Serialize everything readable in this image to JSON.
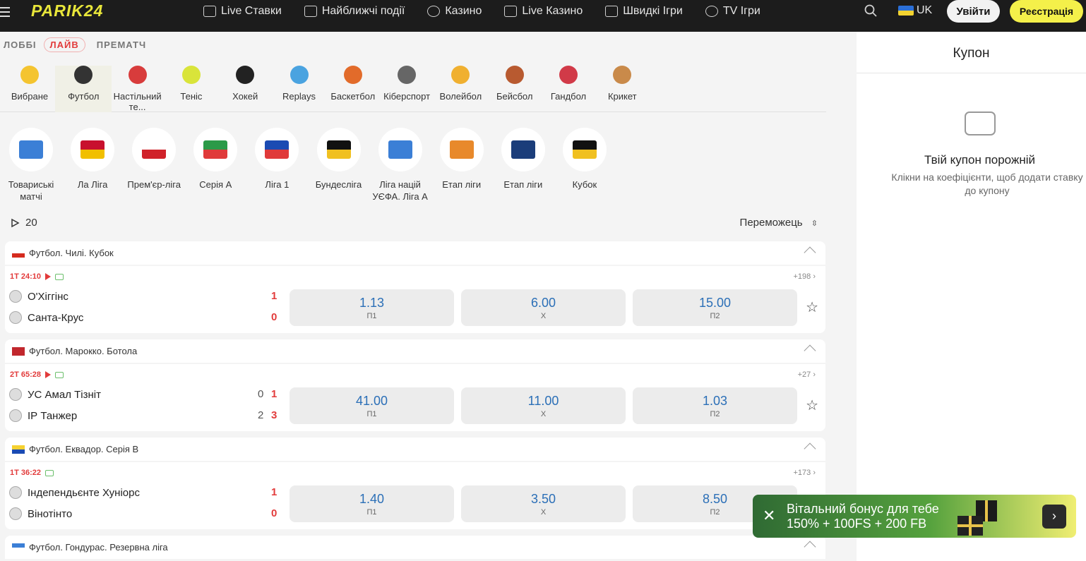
{
  "header": {
    "logo": "PARIK24",
    "nav": [
      {
        "label": "Live Ставки",
        "icon": "live-bets-icon"
      },
      {
        "label": "Найближчі події",
        "icon": "calendar-icon"
      },
      {
        "label": "Казино",
        "icon": "casino-chip-icon"
      },
      {
        "label": "Live Казино",
        "icon": "live-casino-icon"
      },
      {
        "label": "Швидкі Ігри",
        "icon": "rocket-icon"
      },
      {
        "label": "TV Ігри",
        "icon": "tv-games-icon"
      }
    ],
    "language": "UK",
    "login": "Увійти",
    "register": "Реєстрація"
  },
  "tabs": [
    "ЛОББІ",
    "ЛАЙВ",
    "ПРЕМАТЧ"
  ],
  "active_tab": "ЛАЙВ",
  "sports": [
    {
      "label": "Вибране",
      "color": "#f4c430"
    },
    {
      "label": "Футбол",
      "color": "#333333"
    },
    {
      "label": "Настільний те...",
      "color": "#d83c3c"
    },
    {
      "label": "Теніс",
      "color": "#d9e43a"
    },
    {
      "label": "Хокей",
      "color": "#222222"
    },
    {
      "label": "Replays",
      "color": "#4aa3e0"
    },
    {
      "label": "Баскетбол",
      "color": "#e26b2a"
    },
    {
      "label": "Кіберспорт",
      "color": "#666666"
    },
    {
      "label": "Волейбол",
      "color": "#f0b030"
    },
    {
      "label": "Бейсбол",
      "color": "#b85a30"
    },
    {
      "label": "Гандбол",
      "color": "#d13a48"
    },
    {
      "label": "Крикет",
      "color": "#c98a4a"
    }
  ],
  "leagues": [
    {
      "label": "Товариські матчі",
      "colors": [
        "#3b7fd6",
        "#3b7fd6"
      ]
    },
    {
      "label": "Ла Ліга",
      "colors": [
        "#c8102e",
        "#f1bf00"
      ]
    },
    {
      "label": "Прем'єр-ліга",
      "colors": [
        "#ffffff",
        "#d0222a"
      ]
    },
    {
      "label": "Серія А",
      "colors": [
        "#2b9a48",
        "#e03a3a"
      ]
    },
    {
      "label": "Ліга 1",
      "colors": [
        "#1b4bb3",
        "#e03a3a"
      ]
    },
    {
      "label": "Бундесліга",
      "colors": [
        "#111111",
        "#f0c020"
      ]
    },
    {
      "label": "Ліга націй УЄФА. Ліга А",
      "colors": [
        "#3b7fd6",
        "#3b7fd6"
      ]
    },
    {
      "label": "Етап ліги",
      "colors": [
        "#e8892b",
        "#e8892b"
      ]
    },
    {
      "label": "Етап ліги",
      "colors": [
        "#1b3d7a",
        "#1b3d7a"
      ]
    },
    {
      "label": "Кубок",
      "colors": [
        "#111111",
        "#f0c020"
      ]
    }
  ],
  "live_count": "20",
  "market_selector": "Переможець",
  "groups": [
    {
      "title": "Футбол. Чилі. Кубок",
      "flag": [
        "#ffffff",
        "#d52b1e"
      ],
      "time": "1Т 24:10",
      "more": "+198",
      "teams": [
        {
          "name": "О'Хіггінс",
          "score": "1",
          "period": ""
        },
        {
          "name": "Санта-Крус",
          "score": "0",
          "period": ""
        }
      ],
      "odds": [
        {
          "v": "1.13",
          "l": "П1"
        },
        {
          "v": "6.00",
          "l": "Х"
        },
        {
          "v": "15.00",
          "l": "П2"
        }
      ]
    },
    {
      "title": "Футбол. Марокко. Ботола",
      "flag": [
        "#c1272d",
        "#c1272d"
      ],
      "time": "2Т 65:28",
      "more": "+27",
      "teams": [
        {
          "name": "УС Амал Тізніт",
          "score": "1",
          "period": "0"
        },
        {
          "name": "ІР Танжер",
          "score": "3",
          "period": "2"
        }
      ],
      "odds": [
        {
          "v": "41.00",
          "l": "П1"
        },
        {
          "v": "11.00",
          "l": "Х"
        },
        {
          "v": "1.03",
          "l": "П2"
        }
      ]
    },
    {
      "title": "Футбол. Еквадор. Серія B",
      "flag": [
        "#f5d130",
        "#1b4bb3"
      ],
      "time": "1Т 36:22",
      "more": "+173",
      "teams": [
        {
          "name": "Індепендьєнте Хуніорс",
          "score": "1",
          "period": ""
        },
        {
          "name": "Вінотінто",
          "score": "0",
          "period": ""
        }
      ],
      "odds": [
        {
          "v": "1.40",
          "l": "П1"
        },
        {
          "v": "3.50",
          "l": "Х"
        },
        {
          "v": "8.50",
          "l": "П2"
        }
      ]
    },
    {
      "title": "Футбол. Гондурас. Резервна ліга",
      "flag": [
        "#3b7fd6",
        "#ffffff"
      ]
    }
  ],
  "coupon": {
    "title": "Купон",
    "empty_title": "Твій купон порожній",
    "empty_text_line1": "Клікни на коефіцієнти, щоб додати ставку",
    "empty_text_line2": "до купону"
  },
  "bonus": {
    "line1": "Вітальний бонус для тебе",
    "line2": "150% + 100FS + 200 FB"
  }
}
